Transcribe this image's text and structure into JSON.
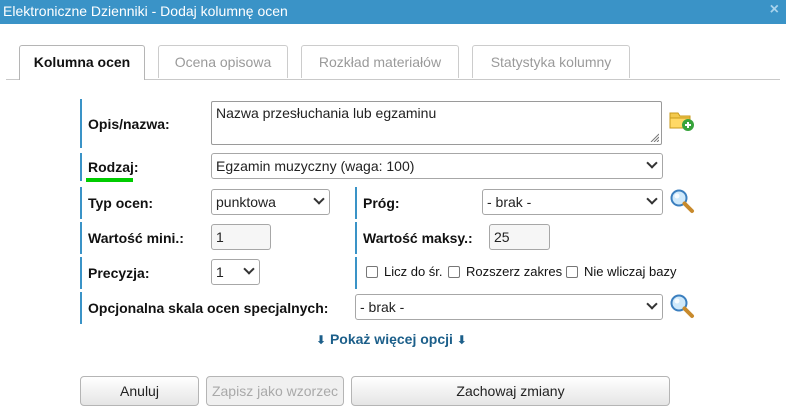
{
  "window": {
    "title": "Elektroniczne Dzienniki - Dodaj kolumnę ocen",
    "close_glyph": "×"
  },
  "tabs": [
    {
      "label": "Kolumna ocen",
      "active": true
    },
    {
      "label": "Ocena opisowa",
      "active": false
    },
    {
      "label": "Rozkład materiałów",
      "active": false
    },
    {
      "label": "Statystyka kolumny",
      "active": false
    }
  ],
  "form": {
    "opis_label": "Opis/nazwa:",
    "opis_value": "Nazwa przesłuchania lub egzaminu",
    "rodzaj_label": "Rodzaj:",
    "rodzaj_value": "Egzamin muzyczny (waga: 100)",
    "typ_label": "Typ ocen:",
    "typ_value": "punktowa",
    "prog_label": "Próg:",
    "prog_value": "- brak -",
    "min_label": "Wartość mini.:",
    "min_value": "1",
    "max_label": "Wartość maksy.:",
    "max_value": "25",
    "precyzja_label": "Precyzja:",
    "precyzja_value": "1",
    "checkboxes": [
      {
        "label": "Licz do śr.",
        "checked": false
      },
      {
        "label": "Rozszerz zakres",
        "checked": false
      },
      {
        "label": "Nie wliczaj bazy",
        "checked": false
      }
    ],
    "skala_label": "Opcjonalna skala ocen specjalnych:",
    "skala_value": "- brak -",
    "more_options": "Pokaż więcej opcji"
  },
  "buttons": {
    "cancel": "Anuluj",
    "save_template": "Zapisz jako wzorzec",
    "save": "Zachowaj zmiany"
  },
  "colors": {
    "titlebar": "#3a93c7",
    "accent_border": "#3a93c7",
    "required_underline": "#00cc00",
    "link": "#1c5f8a"
  },
  "icons": [
    "folder-add-icon",
    "magnifier-icon",
    "chevron-down-icon",
    "close-icon"
  ]
}
